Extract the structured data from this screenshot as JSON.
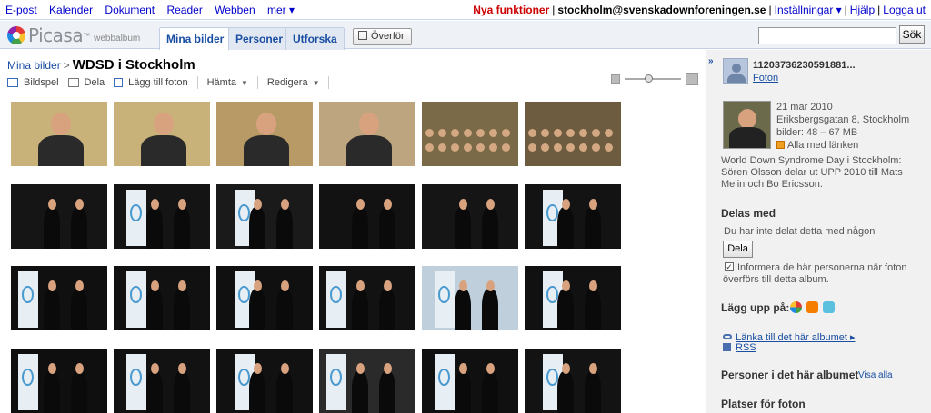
{
  "topbar": {
    "links": [
      "E-post",
      "Kalender",
      "Dokument",
      "Reader",
      "Webben",
      "mer ▾"
    ],
    "new_features": "Nya funktioner",
    "email": "stockholm@svenskadownforeningen.se",
    "settings": "Inställningar ▾",
    "help": "Hjälp",
    "logout": "Logga ut"
  },
  "header": {
    "brand": "Picasa",
    "tm": "™",
    "sub": "webbalbum",
    "tabs": [
      "Mina bilder",
      "Personer",
      "Utforska"
    ],
    "active_tab": "Mina bilder",
    "upload_label": "Överför",
    "search_placeholder": "",
    "search_button": "Sök"
  },
  "album": {
    "breadcrumb_root": "Mina bilder",
    "separator": ">",
    "title": "WDSD i Stockholm",
    "toolbar": {
      "slideshow": "Bildspel",
      "share": "Dela",
      "add_photos": "Lägg till foton",
      "fetch": "Hämta",
      "edit": "Redigera"
    },
    "zoom_level": 0.42,
    "photo_count": 28
  },
  "sidebar": {
    "owner_name": "11203736230591881...",
    "owner_photos_link": "Foton",
    "date": "21 mar 2010",
    "location": "Eriksbergsgatan 8, Stockholm",
    "size": "bilder: 48 – 67 MB",
    "visibility": "Alla med länken",
    "description": "World Down Syndrome Day i Stockholm: Sören Olsson delar ut UPP 2010 till Mats Melin och Bo Ericsson.",
    "shared_with_heading": "Delas med",
    "shared_note": "Du har inte delat detta med någon",
    "share_button": "Dela",
    "notify_checked": true,
    "notify_text": "Informera de här personerna när foton överförs till detta album.",
    "upload_to_heading": "Lägg upp på:",
    "link_album": "Länka till det här albumet",
    "rss": "RSS",
    "people_heading": "Personer i det här albumet",
    "view_all": "Visa alla",
    "places_heading": "Platser för foton"
  },
  "colors": {
    "link": "#1a4ea2",
    "new_features": "#cc0000",
    "header_bg": "#eef1f6",
    "sidebar_bg": "#f1f1f1"
  }
}
